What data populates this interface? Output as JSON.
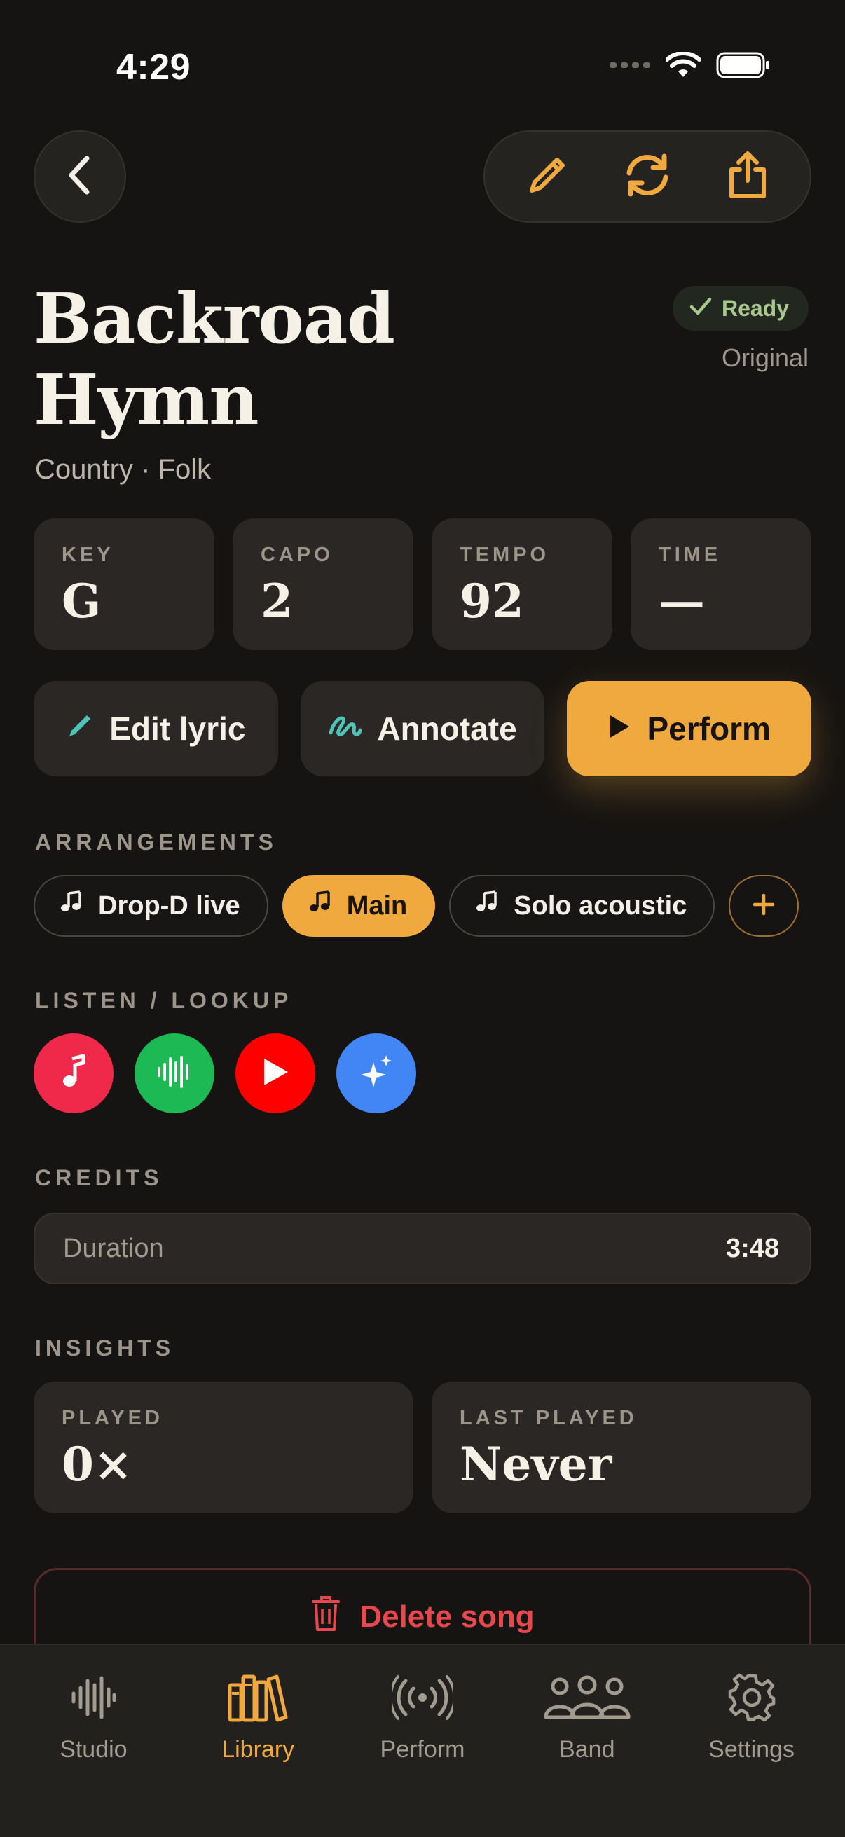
{
  "status": {
    "time": "4:29"
  },
  "song": {
    "title_line1": "Backroad",
    "title_line2": "Hymn",
    "genre": "Country · Folk",
    "status_badge": "Ready",
    "version": "Original"
  },
  "stats": [
    {
      "label": "KEY",
      "value": "G"
    },
    {
      "label": "CAPO",
      "value": "2"
    },
    {
      "label": "TEMPO",
      "value": "92"
    },
    {
      "label": "TIME",
      "value": "—"
    }
  ],
  "actions": {
    "edit_lyric": "Edit lyric",
    "annotate": "Annotate",
    "perform": "Perform"
  },
  "arrangements": {
    "label": "ARRANGEMENTS",
    "items": [
      {
        "label": "Drop-D live",
        "active": false
      },
      {
        "label": "Main",
        "active": true
      },
      {
        "label": "Solo acoustic",
        "active": false
      }
    ]
  },
  "listen": {
    "label": "LISTEN / LOOKUP",
    "services": [
      {
        "icon": "music-note-icon",
        "color": "#f0284a"
      },
      {
        "icon": "waveform-icon",
        "color": "#1db954"
      },
      {
        "icon": "play-icon",
        "color": "#ff0000"
      },
      {
        "icon": "sparkle-icon",
        "color": "#4285f4"
      }
    ]
  },
  "credits": {
    "label": "CREDITS",
    "duration_key": "Duration",
    "duration_val": "3:48"
  },
  "insights": {
    "label": "INSIGHTS",
    "played_label": "PLAYED",
    "played_value": "0×",
    "last_played_label": "LAST PLAYED",
    "last_played_value": "Never"
  },
  "delete_label": "Delete song",
  "tabs": [
    {
      "label": "Studio",
      "icon": "waveform-icon",
      "active": false
    },
    {
      "label": "Library",
      "icon": "books-icon",
      "active": true
    },
    {
      "label": "Perform",
      "icon": "broadcast-icon",
      "active": false
    },
    {
      "label": "Band",
      "icon": "people-icon",
      "active": false
    },
    {
      "label": "Settings",
      "icon": "gear-icon",
      "active": false
    }
  ],
  "colors": {
    "accent": "#f0a93f",
    "danger": "#e5484d",
    "ready": "#a9c78f",
    "teal": "#4fc3b8"
  }
}
